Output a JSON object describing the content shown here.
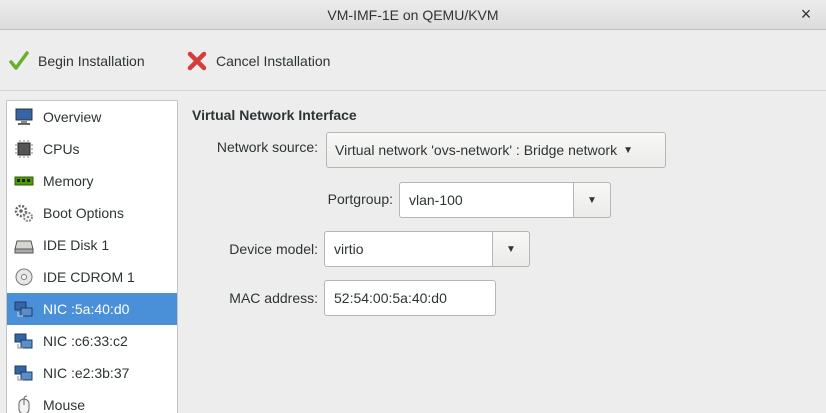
{
  "window": {
    "title": "VM-IMF-1E on QEMU/KVM",
    "close_glyph": "×"
  },
  "toolbar": {
    "begin_label": "Begin Installation",
    "cancel_label": "Cancel Installation",
    "begin_icon": "checkmark-icon",
    "cancel_icon": "cross-icon"
  },
  "sidebar": {
    "selected_index": 6,
    "items": [
      {
        "label": "Overview",
        "icon": "monitor-icon"
      },
      {
        "label": "CPUs",
        "icon": "cpu-icon"
      },
      {
        "label": "Memory",
        "icon": "memory-icon"
      },
      {
        "label": "Boot Options",
        "icon": "gears-icon"
      },
      {
        "label": "IDE Disk 1",
        "icon": "disk-icon"
      },
      {
        "label": "IDE CDROM 1",
        "icon": "cdrom-icon"
      },
      {
        "label": "NIC :5a:40:d0",
        "icon": "nic-icon"
      },
      {
        "label": "NIC :c6:33:c2",
        "icon": "nic-icon"
      },
      {
        "label": "NIC :e2:3b:37",
        "icon": "nic-icon"
      },
      {
        "label": "Mouse",
        "icon": "mouse-icon"
      }
    ]
  },
  "main": {
    "heading": "Virtual Network Interface",
    "network_source": {
      "label": "Network source:",
      "value": "Virtual network 'ovs-network' : Bridge network",
      "arrow": "▼"
    },
    "portgroup": {
      "label": "Portgroup:",
      "value": "vlan-100",
      "arrow": "▼"
    },
    "device_model": {
      "label": "Device model:",
      "value": "virtio",
      "arrow": "▼"
    },
    "mac_address": {
      "label": "MAC address:",
      "value": "52:54:00:5a:40:d0"
    }
  },
  "colors": {
    "selection": "#4a90d9",
    "window_bg": "#ededed",
    "check_green": "#6ab02d",
    "cross_red": "#d83b3b"
  }
}
